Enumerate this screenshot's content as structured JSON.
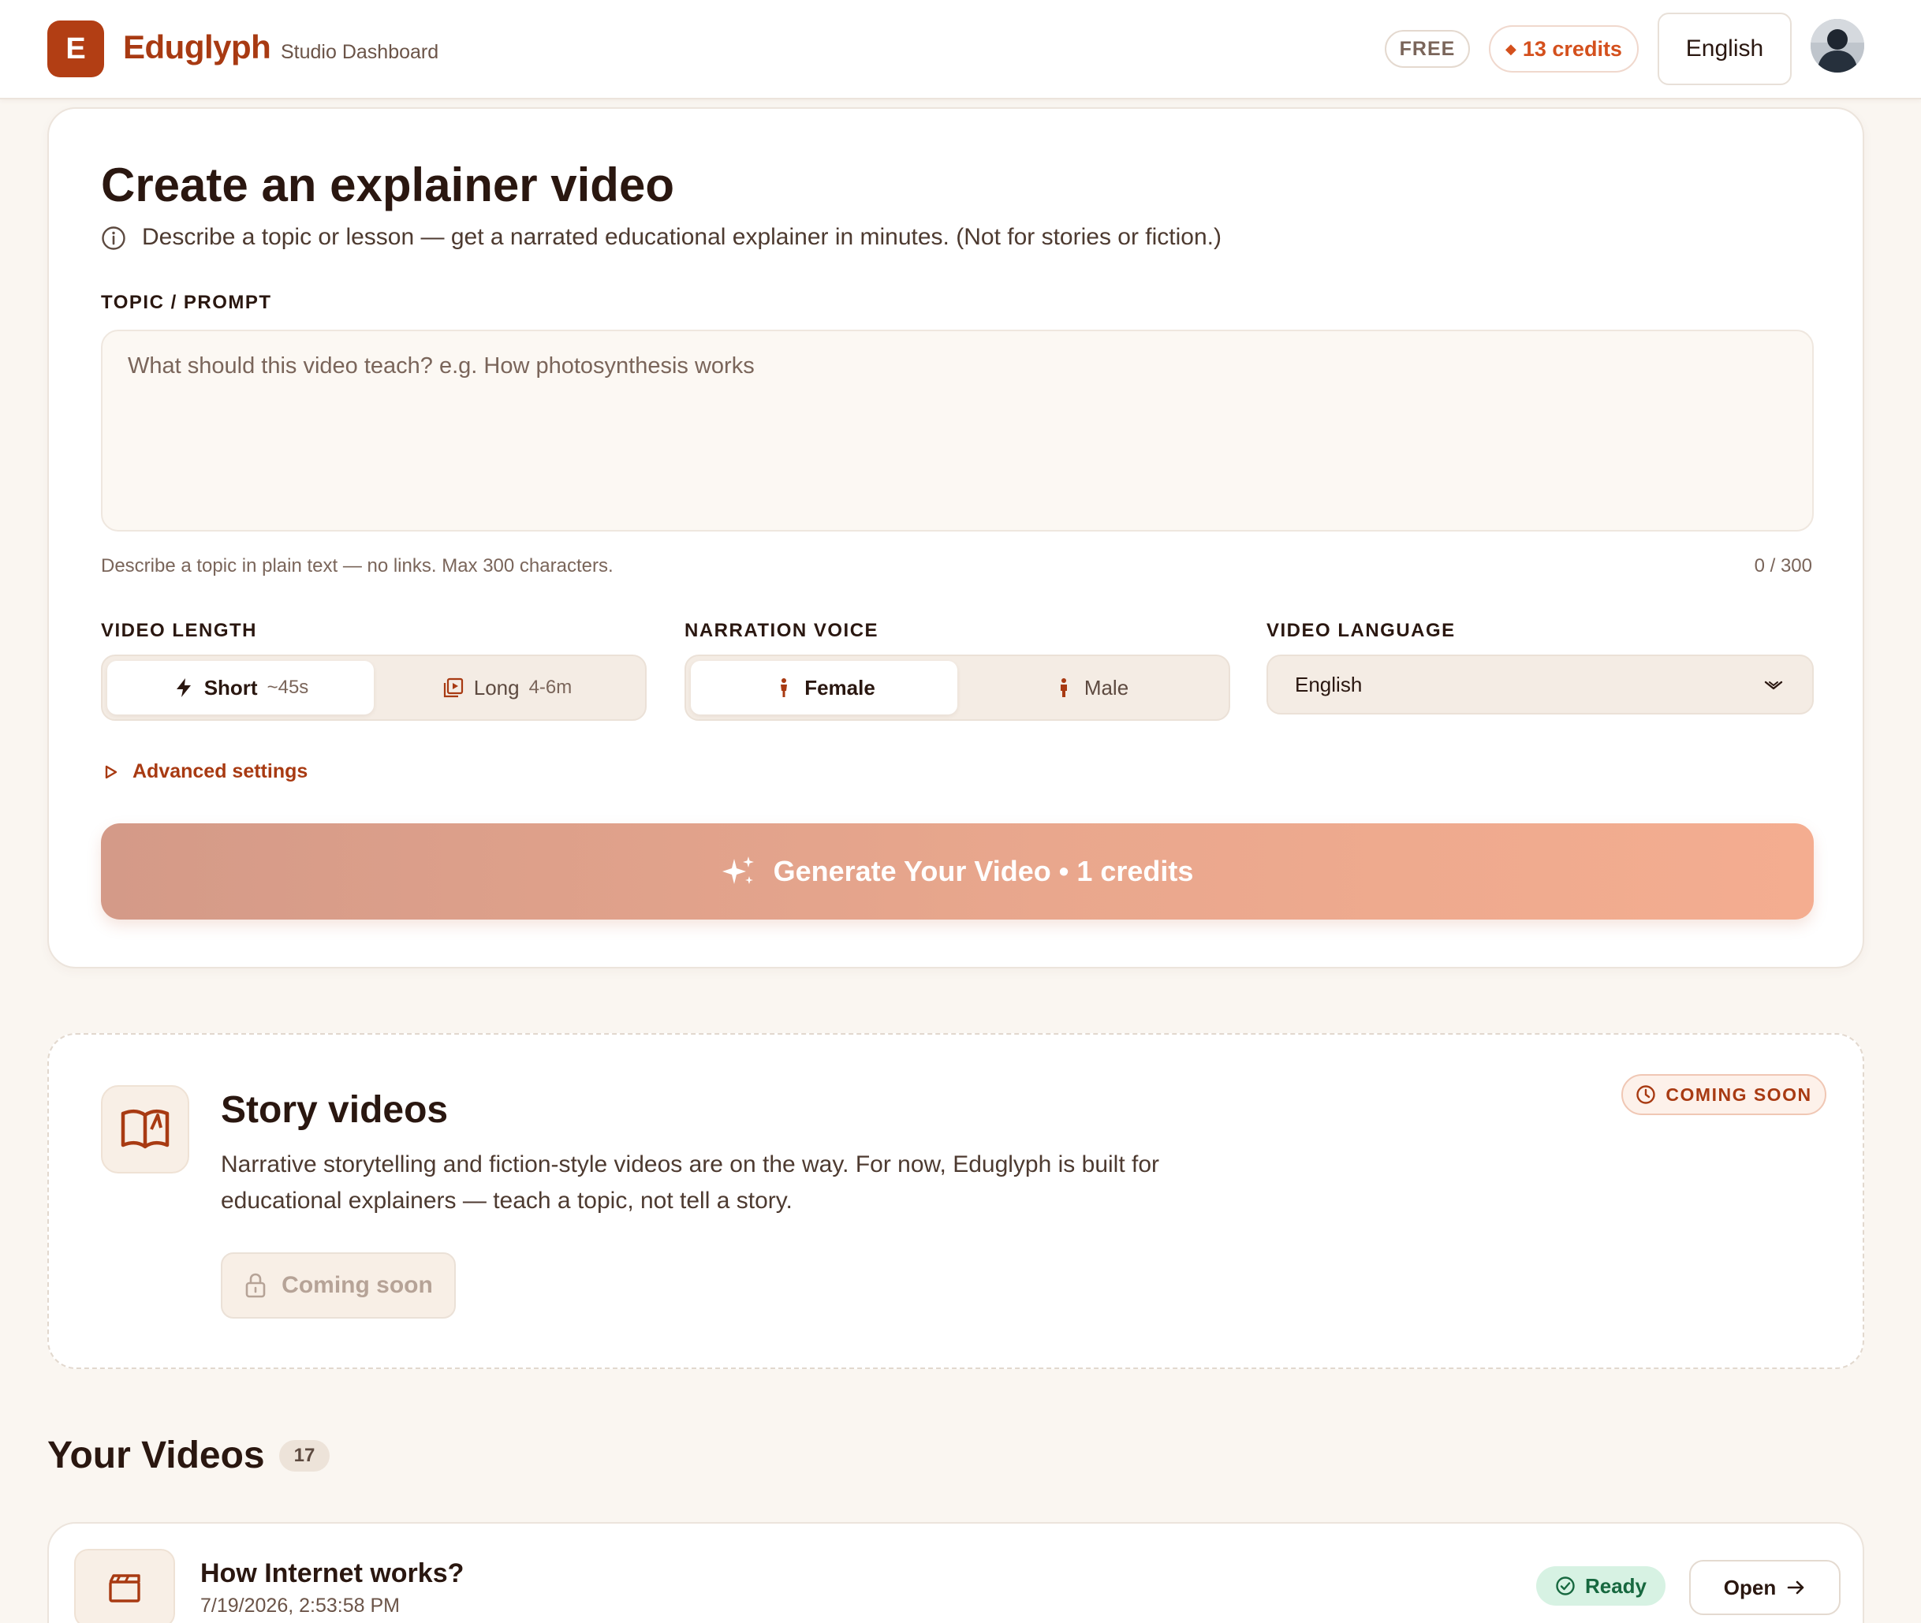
{
  "header": {
    "logo_letter": "E",
    "brand_name": "Eduglyph",
    "brand_sub": "Studio Dashboard",
    "plan": "FREE",
    "credits": "13 credits",
    "language": "English"
  },
  "create": {
    "title": "Create an explainer video",
    "description": "Describe a topic or lesson — get a narrated educational explainer in minutes. (Not for stories or fiction.)",
    "prompt_label": "TOPIC / PROMPT",
    "prompt_value": "",
    "prompt_placeholder": "What should this video teach? e.g. How photosynthesis works",
    "helper": "Describe a topic in plain text — no links. Max 300 characters.",
    "char_count": "0 / 300",
    "length_label": "VIDEO LENGTH",
    "length_options": [
      {
        "label": "Short",
        "meta": "~45s",
        "active": true
      },
      {
        "label": "Long",
        "meta": "4-6m",
        "active": false
      }
    ],
    "voice_label": "NARRATION VOICE",
    "voice_options": [
      {
        "label": "Female",
        "active": true
      },
      {
        "label": "Male",
        "active": false
      }
    ],
    "language_label": "VIDEO LANGUAGE",
    "language_value": "English",
    "advanced": "Advanced settings",
    "generate_label": "Generate Your Video • 1 credits"
  },
  "story": {
    "title": "Story videos",
    "description": "Narrative storytelling and fiction-style videos are on the way. For now, Eduglyph is built for educational explainers — teach a topic, not tell a story.",
    "badge": "COMING SOON",
    "button": "Coming soon"
  },
  "videos": {
    "title": "Your Videos",
    "count": "17",
    "items": [
      {
        "title": "How Internet works?",
        "date": "7/19/2026, 2:53:58 PM",
        "status": "Ready",
        "action": "Open"
      }
    ]
  },
  "colors": {
    "brand": "#b23e14",
    "accent": "#d4501d",
    "background": "#faf6f1",
    "ready": "#17683f"
  }
}
